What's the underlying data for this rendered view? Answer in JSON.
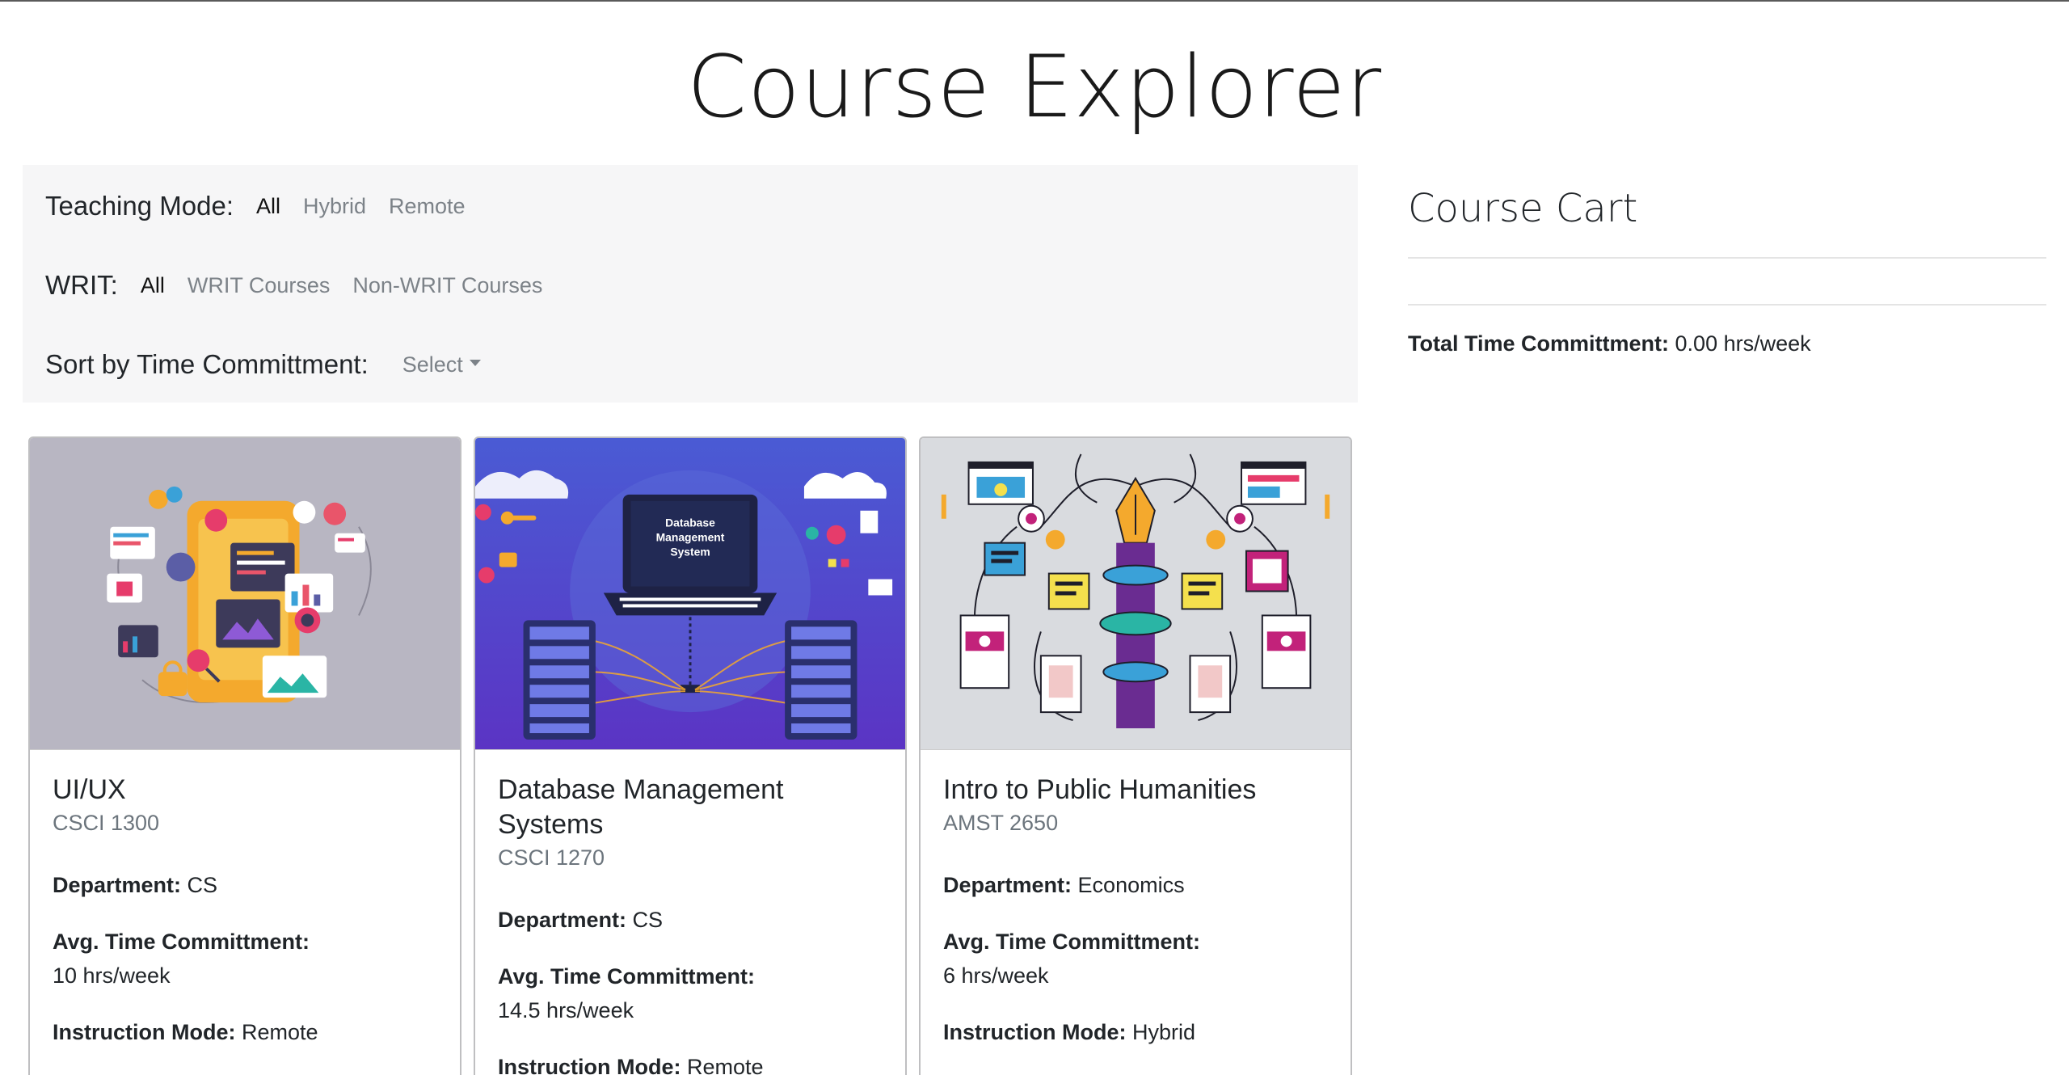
{
  "page": {
    "title": "Course Explorer"
  },
  "filters": {
    "teaching_mode": {
      "label": "Teaching Mode:",
      "options": [
        "All",
        "Hybrid",
        "Remote"
      ],
      "selected": "All"
    },
    "writ": {
      "label": "WRIT:",
      "options": [
        "All",
        "WRIT Courses",
        "Non-WRIT Courses"
      ],
      "selected": "All"
    },
    "sort": {
      "label": "Sort by Time Committment:",
      "dropdown": "Select"
    }
  },
  "labels": {
    "department": "Department:",
    "time": "Avg. Time Committment:",
    "mode": "Instruction Mode:"
  },
  "courses": [
    {
      "title": "UI/UX",
      "code": "CSCI 1300",
      "department": "CS",
      "time": "10 hrs/week",
      "mode": "Remote"
    },
    {
      "title": "Database Management Systems",
      "code": "CSCI 1270",
      "department": "CS",
      "time": "14.5 hrs/week",
      "mode": "Remote",
      "image_text": [
        "Database",
        "Management",
        "System"
      ]
    },
    {
      "title": "Intro to Public Humanities",
      "code": "AMST 2650",
      "department": "Economics",
      "time": "6 hrs/week",
      "mode": "Hybrid"
    }
  ],
  "cart": {
    "title": "Course Cart",
    "total_label": "Total Time Committment:",
    "total_value": "0.00 hrs/week"
  },
  "colors": {
    "filter_bg": "#f6f6f7",
    "card_border": "#bfbfc1",
    "muted": "#6c757d"
  }
}
